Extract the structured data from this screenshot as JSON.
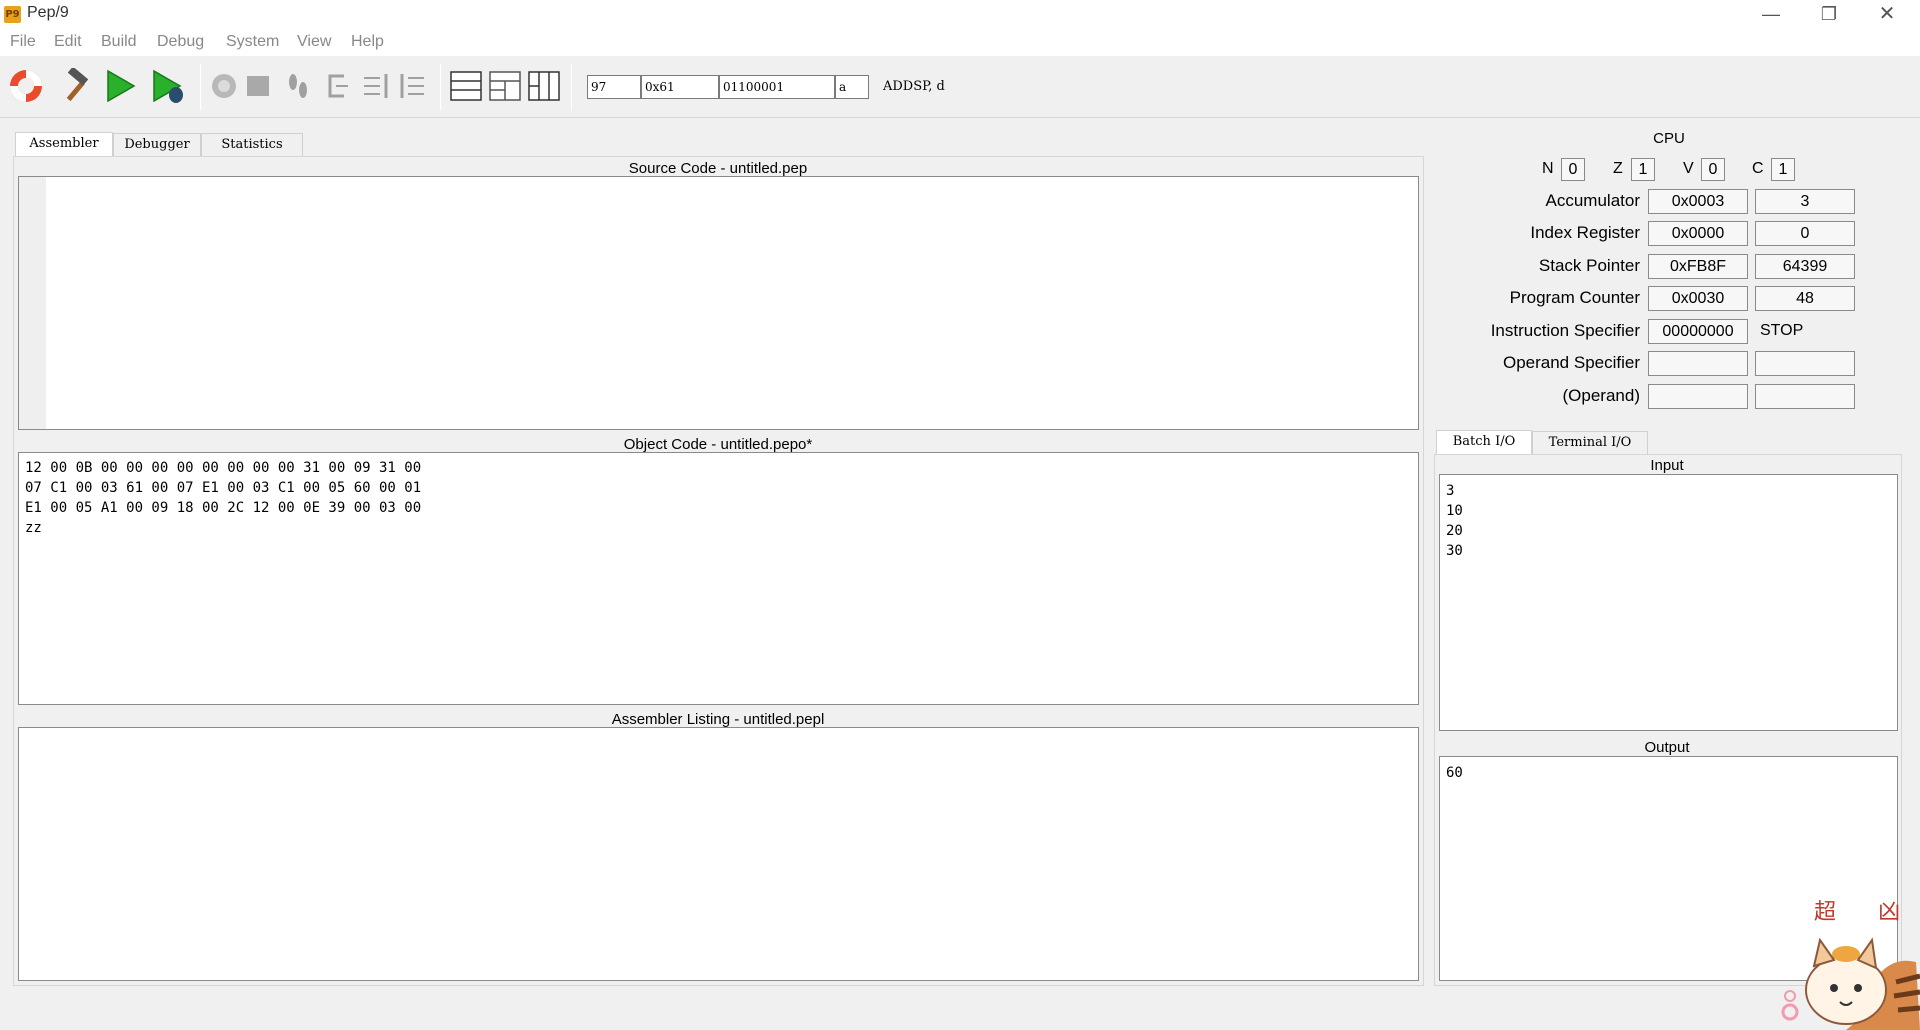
{
  "window": {
    "title": "Pep/9",
    "icon_text": "P9"
  },
  "menu": [
    "File",
    "Edit",
    "Build",
    "Debug",
    "System",
    "View",
    "Help"
  ],
  "toolbar": {
    "icons": [
      "help-lifebuoy-icon",
      "build-hammer-icon",
      "run-icon",
      "run-debug-icon",
      "interrupt-icon",
      "stop-icon",
      "step-icon",
      "step-over-icon",
      "step-into-icon",
      "step-out-icon",
      "layout-rows-icon",
      "layout-mixed-icon",
      "layout-columns-icon"
    ],
    "converter": {
      "decimal": "97",
      "hex": "0x61",
      "binary": "01100001",
      "char": "a",
      "instruction": "ADDSP, d"
    }
  },
  "left_tabs": [
    "Assembler",
    "Debugger",
    "Statistics"
  ],
  "panes": {
    "source_title": "Source Code - untitled.pep",
    "object_title": "Object Code - untitled.pepo*",
    "listing_title": "Assembler Listing - untitled.pepl",
    "object_lines": [
      "12 00 0B 00 00 00 00 00 00 00 00 31 00 09 31 00",
      "07 C1 00 03 61 00 07 E1 00 03 C1 00 05 60 00 01",
      "E1 00 05 A1 00 09 18 00 2C 12 00 0E 39 00 03 00",
      "zz"
    ]
  },
  "cpu": {
    "title": "CPU",
    "flags": [
      {
        "name": "N",
        "value": "0"
      },
      {
        "name": "Z",
        "value": "1"
      },
      {
        "name": "V",
        "value": "0"
      },
      {
        "name": "C",
        "value": "1"
      }
    ],
    "registers": [
      {
        "label": "Accumulator",
        "hex": "0x0003",
        "dec": "3"
      },
      {
        "label": "Index Register",
        "hex": "0x0000",
        "dec": "0"
      },
      {
        "label": "Stack Pointer",
        "hex": "0xFB8F",
        "dec": "64399"
      },
      {
        "label": "Program Counter",
        "hex": "0x0030",
        "dec": "48"
      },
      {
        "label": "Instruction Specifier",
        "hex": "00000000",
        "dec": "STOP"
      },
      {
        "label": "Operand Specifier",
        "hex": "",
        "dec": ""
      },
      {
        "label": "(Operand)",
        "hex": "",
        "dec": ""
      }
    ]
  },
  "io": {
    "tabs": [
      "Batch I/O",
      "Terminal I/O"
    ],
    "input_label": "Input",
    "output_label": "Output",
    "input_lines": [
      "3",
      "10",
      "20",
      "30"
    ],
    "output_lines": [
      "60"
    ]
  },
  "sticker": {
    "text": "超 凶"
  }
}
